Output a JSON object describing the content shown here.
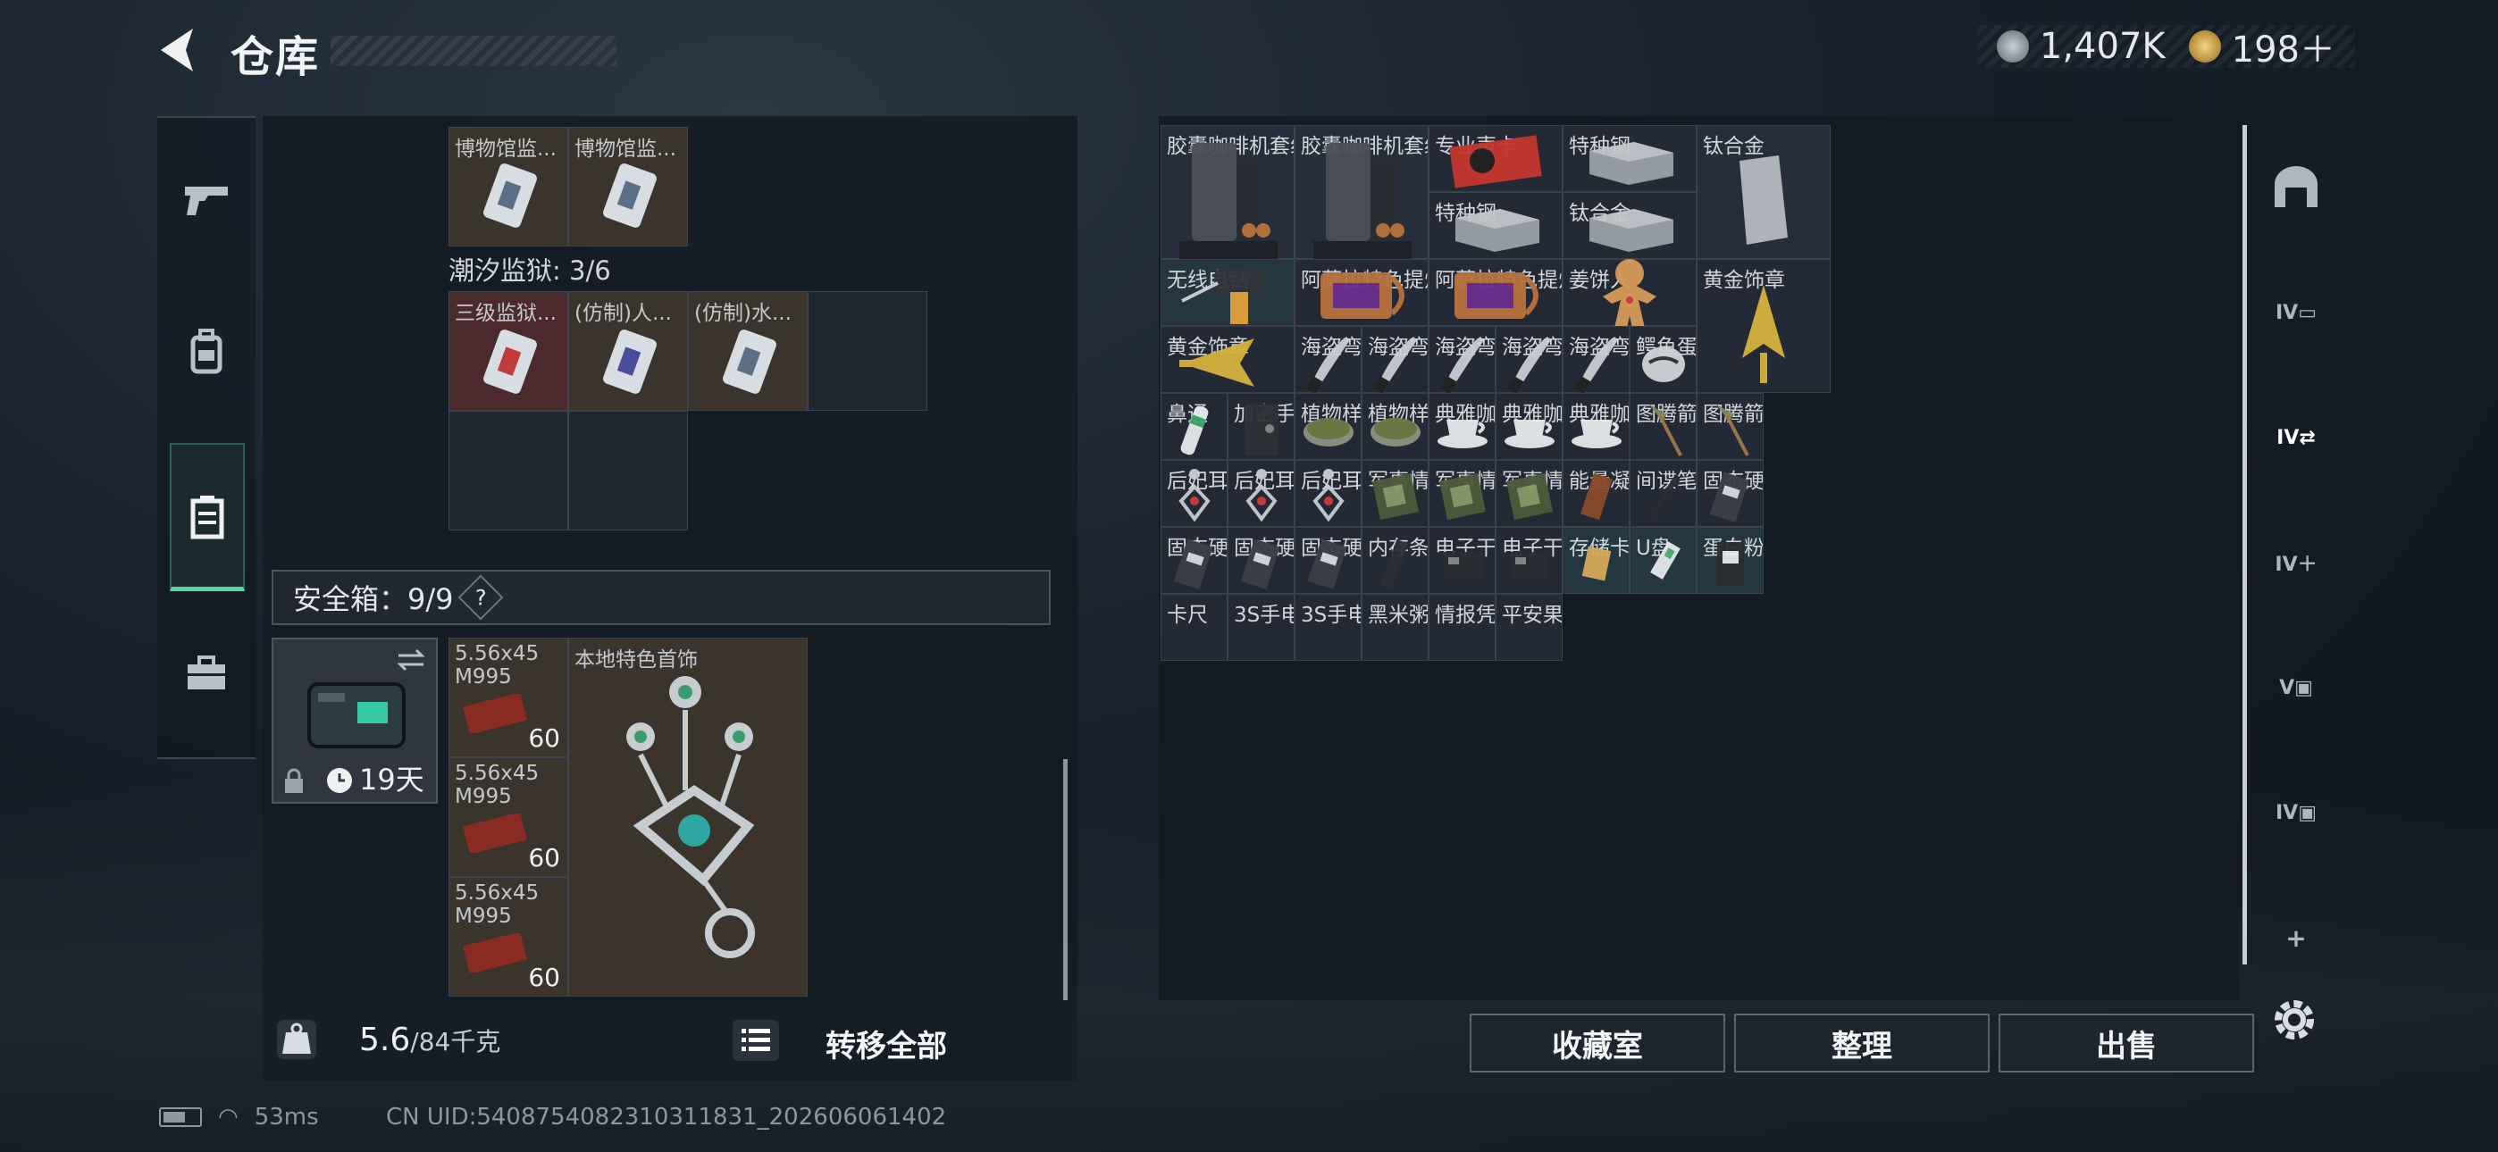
{
  "header": {
    "title": "仓库",
    "currency1": "1,407K",
    "currency2": "198＋"
  },
  "left_nav": {
    "items": [
      "pistol-icon",
      "backpack-icon",
      "container-icon",
      "toolbox-icon"
    ]
  },
  "left_panel": {
    "top_row": [
      {
        "label": "博物馆监..."
      },
      {
        "label": "博物馆监..."
      }
    ],
    "section1": "潮汐监狱: 3/6",
    "section1_items": [
      {
        "label": "三级监狱..."
      },
      {
        "label": "(仿制)人..."
      },
      {
        "label": "(仿制)水..."
      }
    ],
    "safe_label": "安全箱：9/9",
    "safe_help": "?",
    "safebox_days": "19天",
    "ammo": [
      {
        "label": "5.56x45 M995",
        "qty": "60"
      },
      {
        "label": "5.56x45 M995",
        "qty": "60"
      },
      {
        "label": "5.56x45 M995",
        "qty": "60"
      }
    ],
    "jewelry": "本地特色首饰"
  },
  "bottom": {
    "weight_value": "5.6",
    "weight_max": "/84千克",
    "transfer_all": "转移全部"
  },
  "grid_items": [
    "胶囊咖啡机套组",
    "胶囊咖啡机套组",
    "专业声卡",
    "特种钢",
    "钛合金",
    "特种钢",
    "钛合金",
    "无线电钻",
    "阿萨拉特色提灯",
    "阿萨拉特色提灯",
    "姜饼人",
    "黄金饰章",
    "黄金饰章",
    "海盗弯刀",
    "海盗弯刀",
    "海盗弯刀",
    "海盗弯刀",
    "海盗弯刀",
    "鳄鱼蛋",
    "鼻通",
    "加密手记",
    "植物样本",
    "植物样本",
    "典雅咖啡杯",
    "典雅咖啡杯",
    "典雅咖啡杯",
    "图腾箭矢",
    "图腾箭矢",
    "后妃耳环",
    "后妃耳环",
    "后妃耳环",
    "军事情报",
    "军事情报",
    "军事情报",
    "能量凝胶",
    "间谍笔",
    "固态硬盘",
    "固态硬盘",
    "固态硬盘",
    "固态硬盘",
    "内存条",
    "电子干扰器",
    "电子干扰器",
    "存储卡",
    "U盘",
    "蛋白粉包",
    "卡尺",
    "3S手电",
    "3S手电",
    "黑米粥",
    "情报凭证",
    "平安果"
  ],
  "buttons": {
    "collection": "收藏室",
    "sort": "整理",
    "sell": "出售"
  },
  "status": {
    "ping": "53ms",
    "uid": "CN UID:5408754082310311831_202606061402"
  }
}
